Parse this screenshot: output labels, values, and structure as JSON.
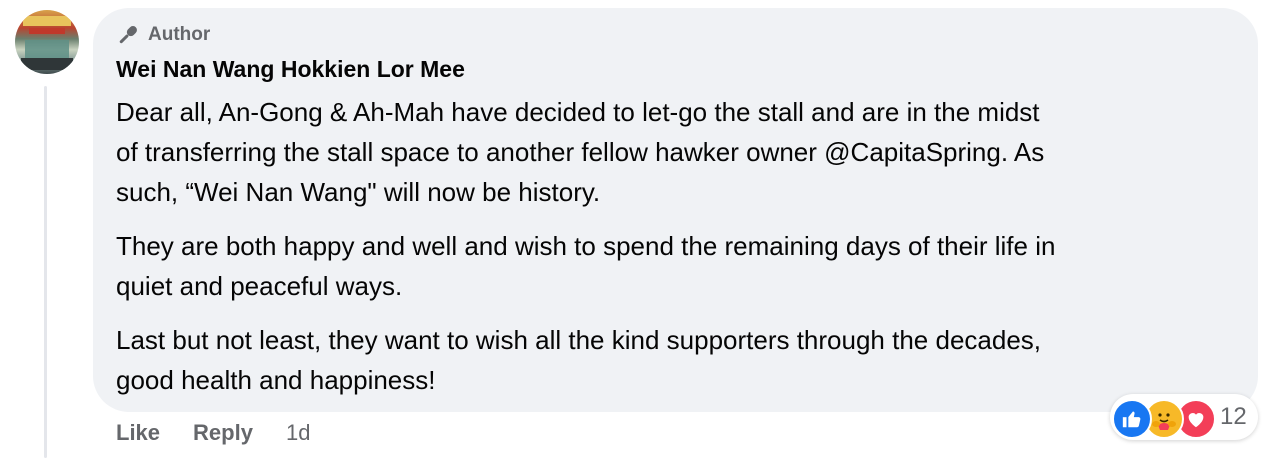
{
  "comment": {
    "badge_label": "Author",
    "author_name": "Wei Nan Wang Hokkien Lor Mee",
    "paragraphs": [
      "Dear all, An-Gong & Ah-Mah have decided to let-go the stall and are in the midst\nof transferring the stall space to another fellow hawker owner @CapitaSpring. As\nsuch, “Wei Nan Wang\" will now be history.",
      "They are both happy and well and wish to spend the remaining days of their life in\nquiet and peaceful ways.",
      "Last but not least, they want to wish all the kind supporters through the decades,\ngood health and happiness!"
    ],
    "actions": {
      "like_label": "Like",
      "reply_label": "Reply",
      "timestamp": "1d"
    },
    "reactions": {
      "icons": [
        "like-reaction-icon",
        "care-reaction-icon",
        "love-reaction-icon"
      ],
      "count": "12"
    }
  },
  "colors": {
    "bubble_bg": "#f0f2f5",
    "muted_text": "#65676b",
    "like_blue": "#1877f2",
    "care_yellow": "#f7b928",
    "love_red": "#f33e58"
  }
}
